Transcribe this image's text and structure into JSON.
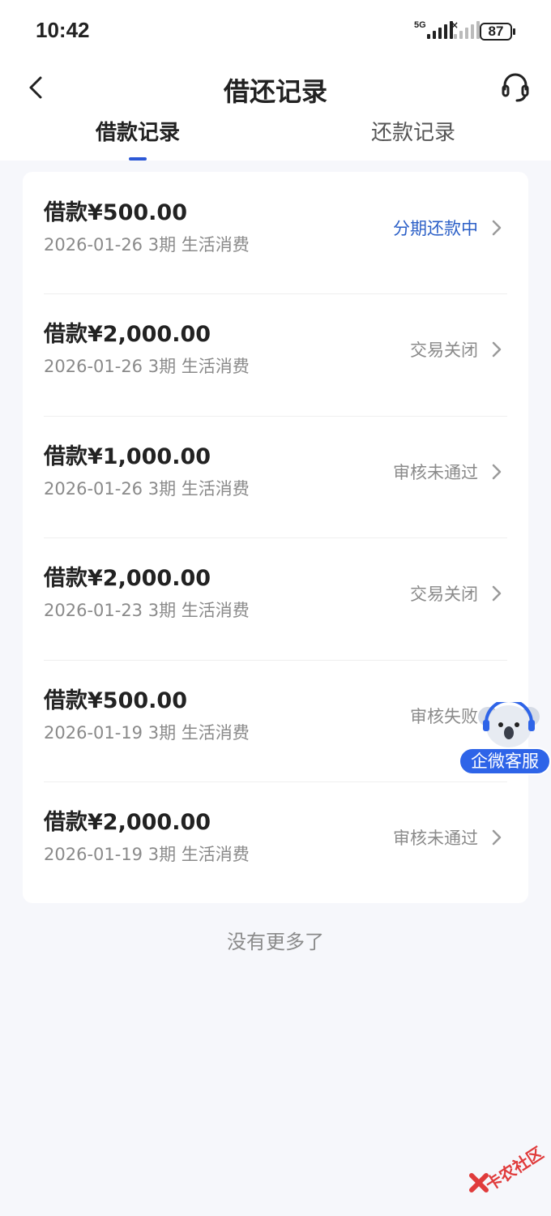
{
  "status_bar": {
    "time": "10:42",
    "network": "5G",
    "battery": "87"
  },
  "header": {
    "title": "借还记录"
  },
  "tabs": [
    {
      "label": "借款记录",
      "active": true
    },
    {
      "label": "还款记录",
      "active": false
    }
  ],
  "records": [
    {
      "amount": "借款¥500.00",
      "meta": "2026-01-26 3期  生活消费",
      "status": "分期还款中",
      "status_color": "#2b5fc7"
    },
    {
      "amount": "借款¥2,000.00",
      "meta": "2026-01-26 3期  生活消费",
      "status": "交易关闭",
      "status_color": "#8a8a8a"
    },
    {
      "amount": "借款¥1,000.00",
      "meta": "2026-01-26 3期  生活消费",
      "status": "审核未通过",
      "status_color": "#8a8a8a"
    },
    {
      "amount": "借款¥2,000.00",
      "meta": "2026-01-23 3期  生活消费",
      "status": "交易关闭",
      "status_color": "#8a8a8a"
    },
    {
      "amount": "借款¥500.00",
      "meta": "2026-01-19 3期  生活消费",
      "status": "审核失败",
      "status_color": "#8a8a8a"
    },
    {
      "amount": "借款¥2,000.00",
      "meta": "2026-01-19 3期  生活消费",
      "status": "审核未通过",
      "status_color": "#8a8a8a"
    }
  ],
  "footer": {
    "no_more": "没有更多了"
  },
  "floating_service": {
    "label": "企微客服",
    "icon": "koala-icon"
  },
  "watermark": {
    "text": "卡农社区"
  }
}
